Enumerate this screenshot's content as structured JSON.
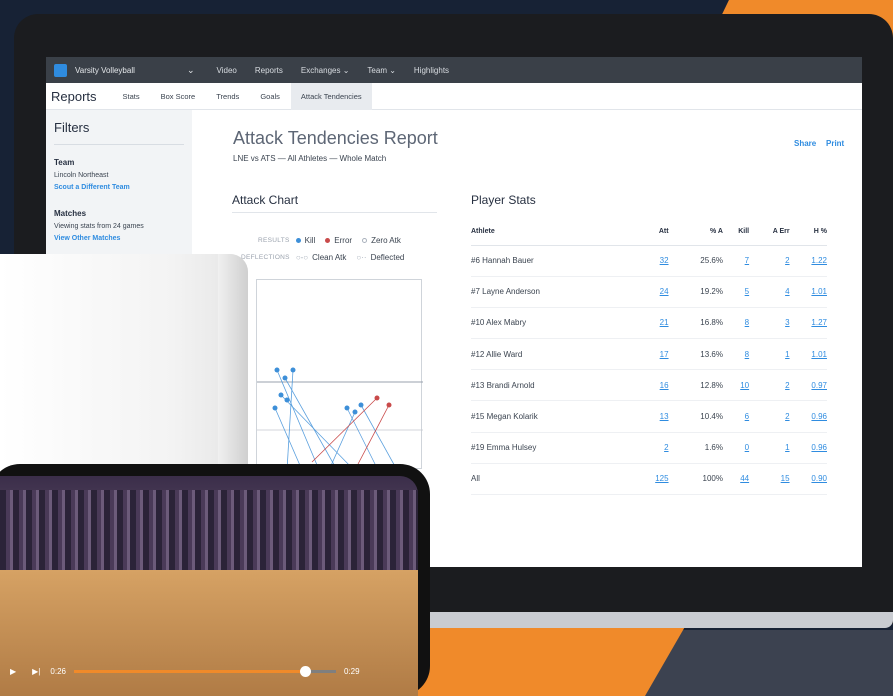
{
  "topnav": {
    "team": "Varsity Volleyball",
    "items": [
      "Video",
      "Reports",
      "Exchanges",
      "Team",
      "Highlights"
    ]
  },
  "subnav": {
    "title": "Reports",
    "items": [
      "Stats",
      "Box Score",
      "Trends",
      "Goals",
      "Attack Tendencies"
    ]
  },
  "sidebar": {
    "title": "Filters",
    "team_heading": "Team",
    "team_value": "Lincoln Northeast",
    "team_link": "Scout a Different Team",
    "matches_heading": "Matches",
    "matches_value": "Viewing stats from 24 games",
    "matches_link": "View Other Matches"
  },
  "report": {
    "title": "Attack Tendencies Report",
    "subtitle": "LNE vs ATS — All Athletes — Whole Match",
    "share": "Share",
    "print": "Print"
  },
  "attack_chart": {
    "title": "Attack Chart",
    "results_label": "RESULTS",
    "deflections_label": "DEFLECTIONS",
    "legend": [
      "Kill",
      "Error",
      "Zero Atk",
      "Clean Atk",
      "Deflected"
    ],
    "colors": {
      "kill": "#3d8fd8",
      "error": "#c94a4a",
      "zero": "#a9b1bc"
    }
  },
  "player_stats": {
    "title": "Player Stats",
    "columns": [
      "Athlete",
      "Att",
      "% A",
      "Kill",
      "A Err",
      "H %"
    ],
    "rows": [
      [
        "#6 Hannah Bauer",
        "32",
        "25.6%",
        "7",
        "2",
        "1.22"
      ],
      [
        "#7 Layne Anderson",
        "24",
        "19.2%",
        "5",
        "4",
        "1.01"
      ],
      [
        "#10 Alex Mabry",
        "21",
        "16.8%",
        "8",
        "3",
        "1.27"
      ],
      [
        "#12 Allie Ward",
        "17",
        "13.6%",
        "8",
        "1",
        "1.01"
      ],
      [
        "#13 Brandi Arnold",
        "16",
        "12.8%",
        "10",
        "2",
        "0.97"
      ],
      [
        "#15 Megan Kolarik",
        "13",
        "10.4%",
        "6",
        "2",
        "0.96"
      ],
      [
        "#19 Emma Hulsey",
        "2",
        "1.6%",
        "0",
        "1",
        "0.96"
      ],
      [
        "All",
        "125",
        "100%",
        "44",
        "15",
        "0.90"
      ]
    ]
  },
  "video": {
    "current_time": "0:26",
    "duration": "0:29",
    "progress": 0.88
  }
}
